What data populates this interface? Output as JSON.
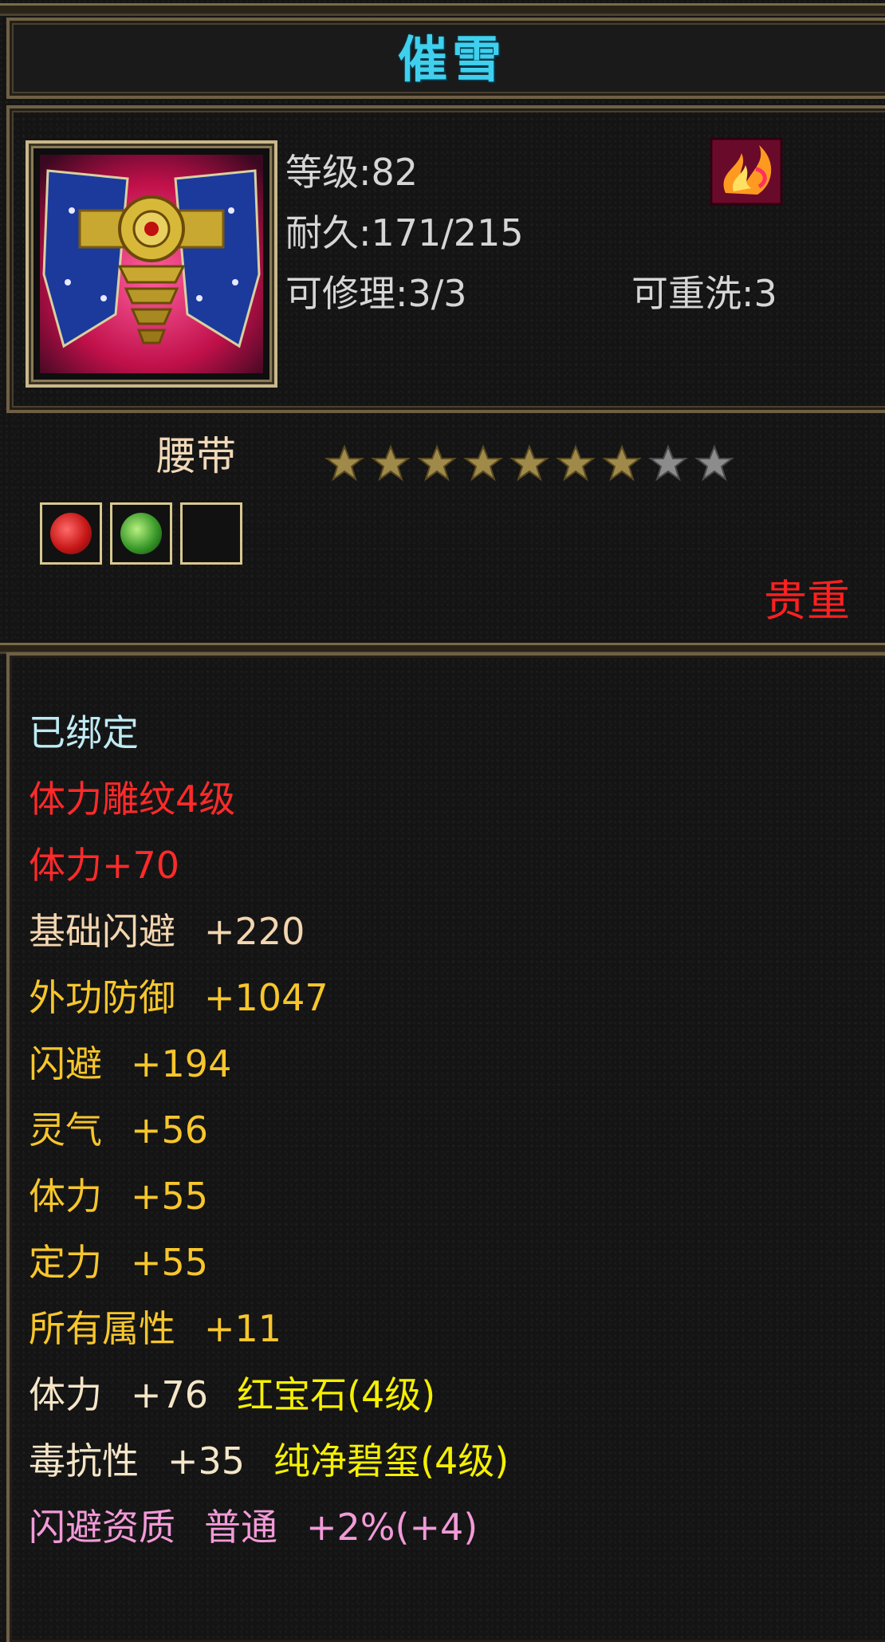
{
  "item": {
    "name": "催雪",
    "level_text": "等级:82",
    "durability_text": "耐久:171/215",
    "repair_text": "可修理:3/3",
    "reroll_text": "可重洗:3",
    "type": "腰带",
    "grade": "贵重",
    "stars": {
      "filled": 7,
      "total": 9
    },
    "sockets": [
      {
        "gem": "ruby-gem-icon",
        "color": "#c81818"
      },
      {
        "gem": "jade-gem-icon",
        "color": "#3a9a2a"
      },
      {
        "gem": "empty-socket",
        "color": ""
      }
    ]
  },
  "attributes": [
    {
      "parts": [
        "已绑定"
      ],
      "colors": [
        "#bfeaf4"
      ]
    },
    {
      "parts": [
        "体力雕纹4级"
      ],
      "colors": [
        "#ff2a2a"
      ]
    },
    {
      "parts": [
        "体力+70"
      ],
      "colors": [
        "#ff2a2a"
      ]
    },
    {
      "parts": [
        "基础闪避",
        "+220"
      ],
      "colors": [
        "#f3d6b0",
        "#f3d6b0"
      ]
    },
    {
      "parts": [
        "外功防御",
        "+1047"
      ],
      "colors": [
        "#f7c62c",
        "#f7c62c"
      ]
    },
    {
      "parts": [
        "闪避",
        "+194"
      ],
      "colors": [
        "#f7c62c",
        "#f7c62c"
      ]
    },
    {
      "parts": [
        "灵气",
        "+56"
      ],
      "colors": [
        "#f7c62c",
        "#f7c62c"
      ]
    },
    {
      "parts": [
        "体力",
        "+55"
      ],
      "colors": [
        "#f7c62c",
        "#f7c62c"
      ]
    },
    {
      "parts": [
        "定力",
        "+55"
      ],
      "colors": [
        "#f7c62c",
        "#f7c62c"
      ]
    },
    {
      "parts": [
        "所有属性",
        "+11"
      ],
      "colors": [
        "#f7c62c",
        "#f7c62c"
      ]
    },
    {
      "parts": [
        "体力",
        "+76",
        "红宝石(4级)"
      ],
      "colors": [
        "#f5e6c8",
        "#f5e6c8",
        "#f5f000"
      ]
    },
    {
      "parts": [
        "毒抗性",
        "+35",
        "纯净碧玺(4级)"
      ],
      "colors": [
        "#f5e6c8",
        "#f5e6c8",
        "#f5f000"
      ]
    },
    {
      "parts": [
        "闪避资质",
        "普通",
        "+2%(+4)"
      ],
      "colors": [
        "#f29ad8",
        "#f29ad8",
        "#f29ad8"
      ]
    }
  ],
  "colors": {
    "title": "#3fd0ee",
    "border": "#6f6045",
    "grade": "#ff2020",
    "star_filled": "#a08a4a",
    "star_empty": "#8c8c8c"
  }
}
